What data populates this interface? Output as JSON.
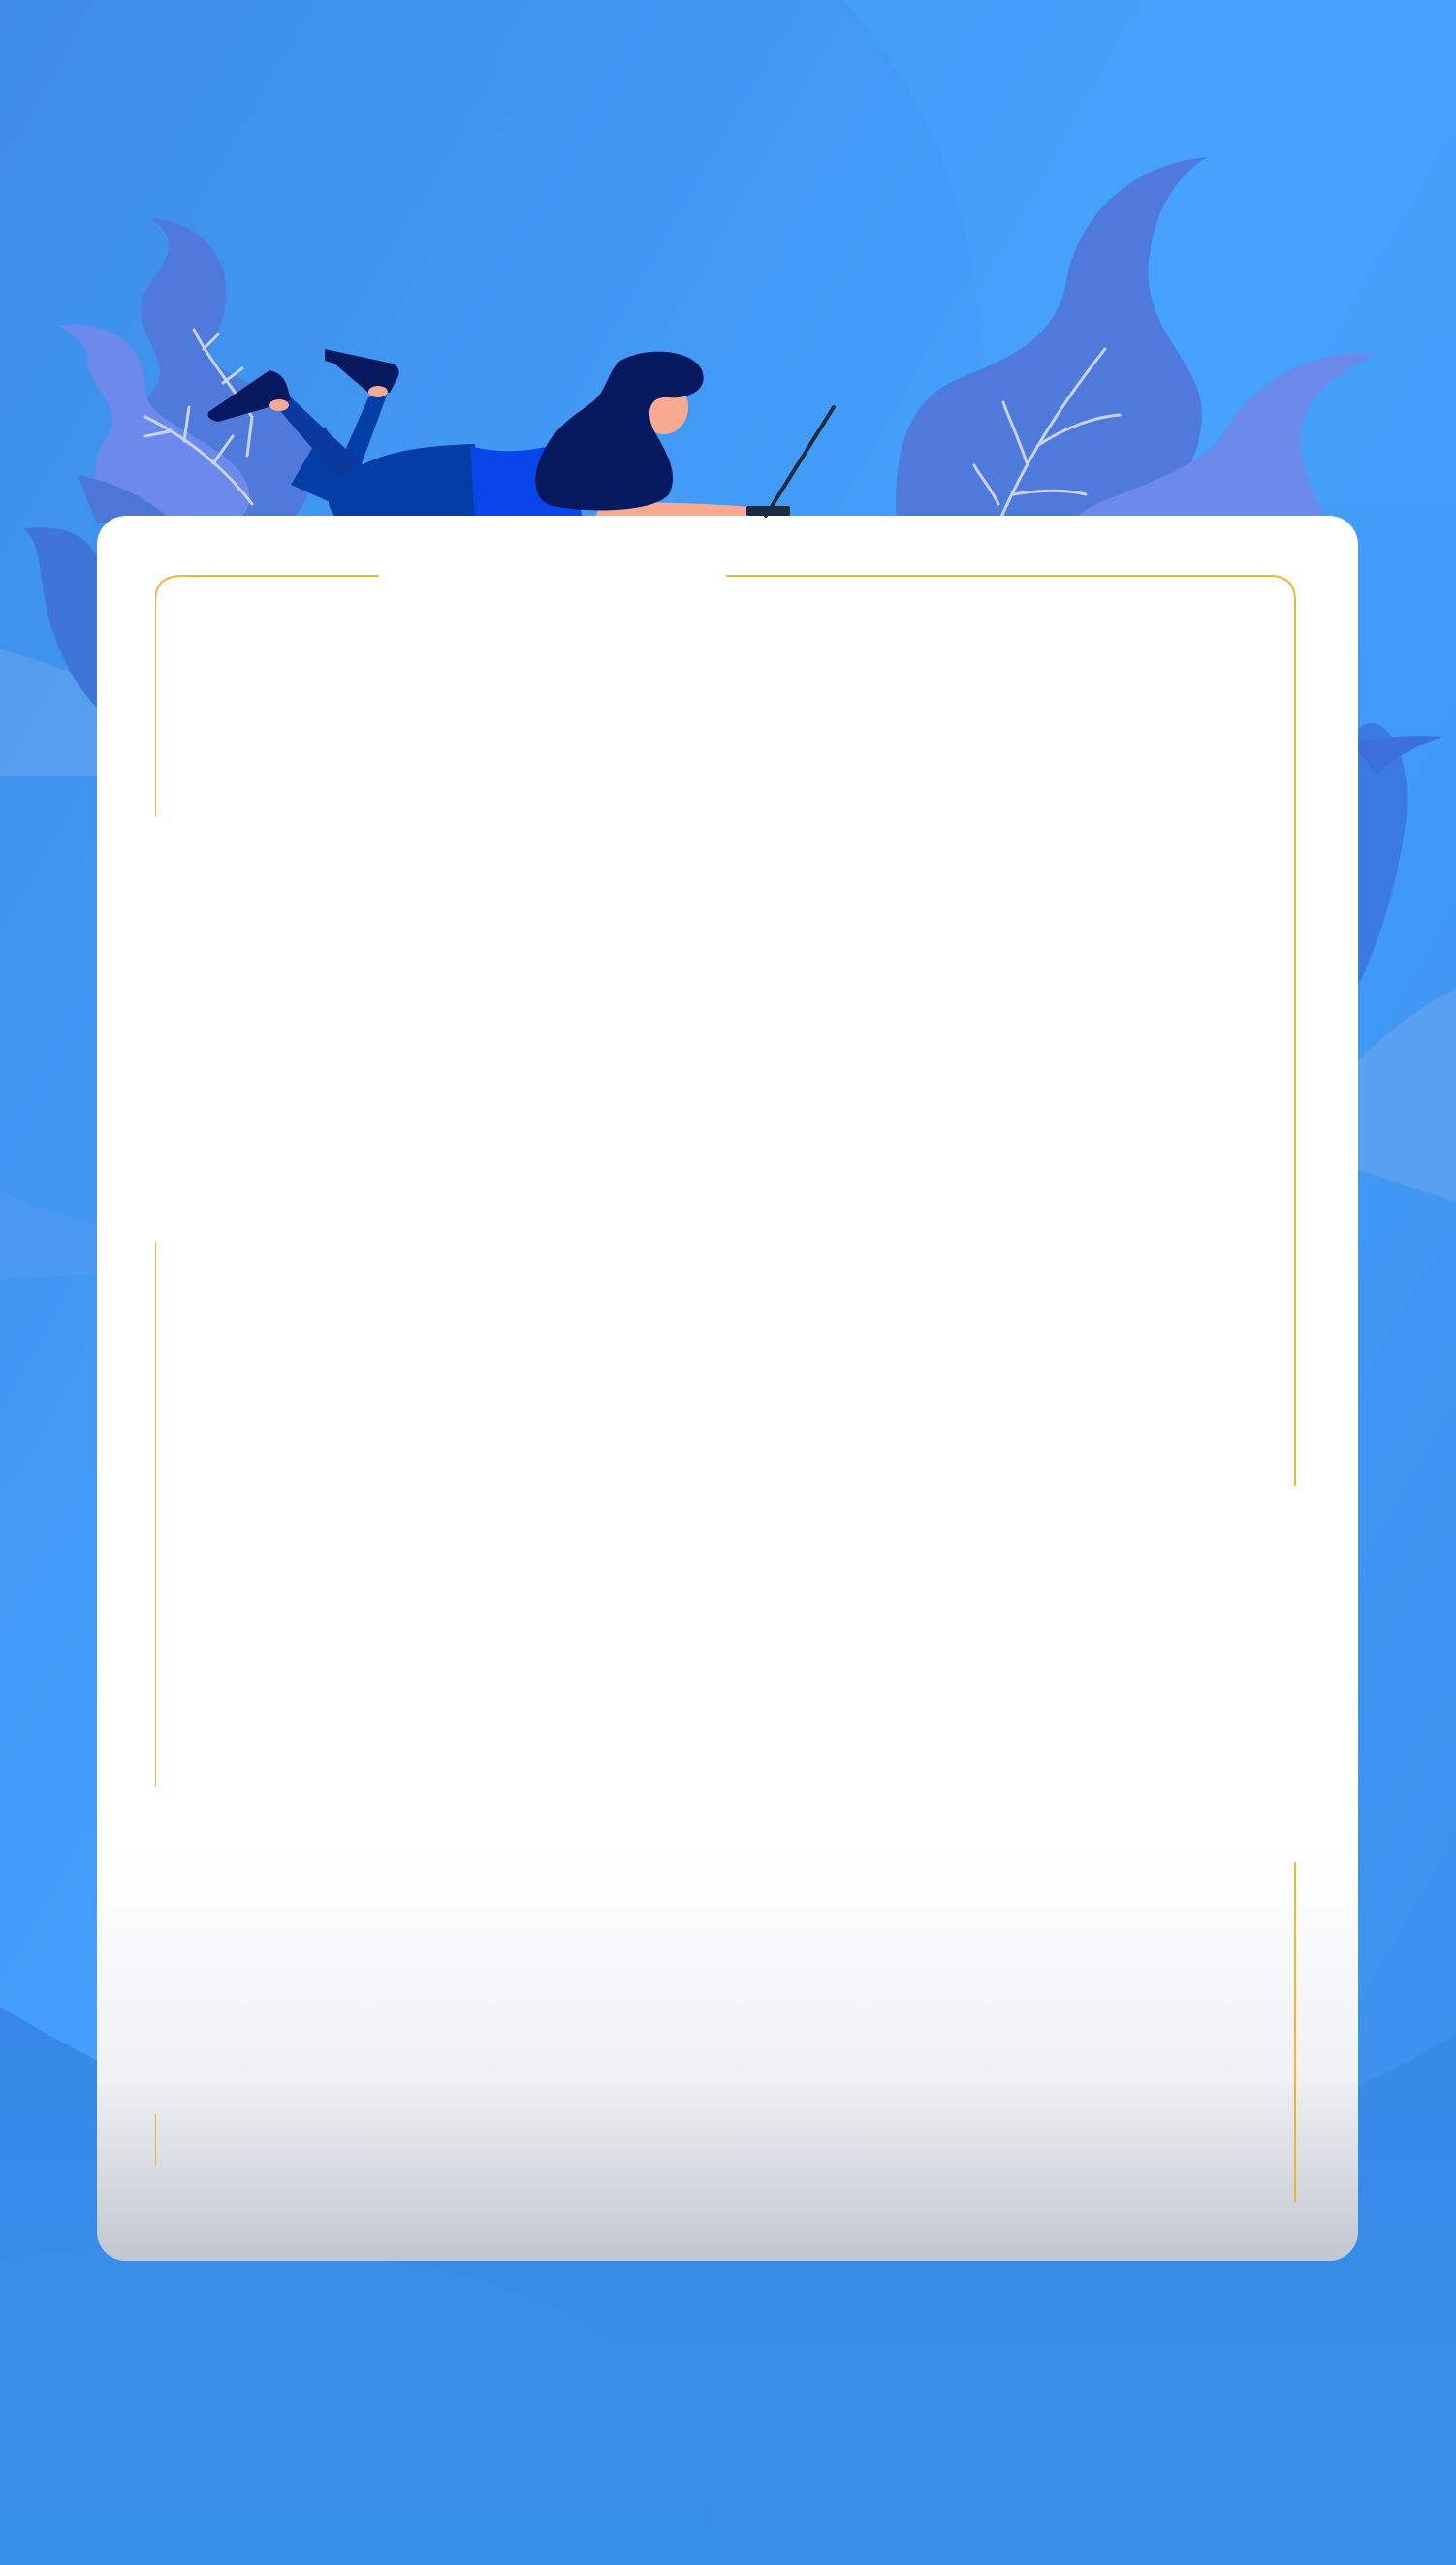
{
  "colors": {
    "background_top": "#46a0fb",
    "background": "#3a8cea",
    "foliage_dark": "#5079dc",
    "foliage_light": "#6b8aeb",
    "card": "#ffffff",
    "frame_line": "#f0b533",
    "figure_hair": "#06185e",
    "figure_shirt": "#0a45ea",
    "figure_pants": "#033ea6",
    "figure_skin": "#f7a992"
  },
  "icons": {
    "illustration": "woman-lying-with-laptop-icon",
    "foliage": "leaf-plant-icon"
  }
}
